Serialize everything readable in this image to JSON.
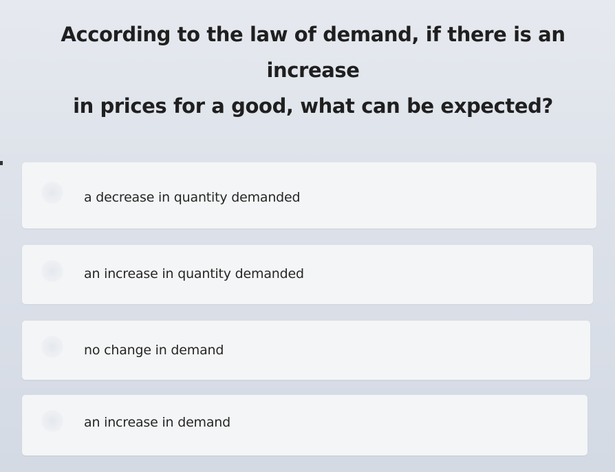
{
  "question": {
    "line1": "According to the law of demand, if there is an increase",
    "line2": "in prices for a good, what can be expected?"
  },
  "answers": [
    {
      "label": "a decrease in quantity demanded"
    },
    {
      "label": "an increase in quantity demanded"
    },
    {
      "label": "no change in demand"
    },
    {
      "label": "an increase in demand"
    }
  ]
}
